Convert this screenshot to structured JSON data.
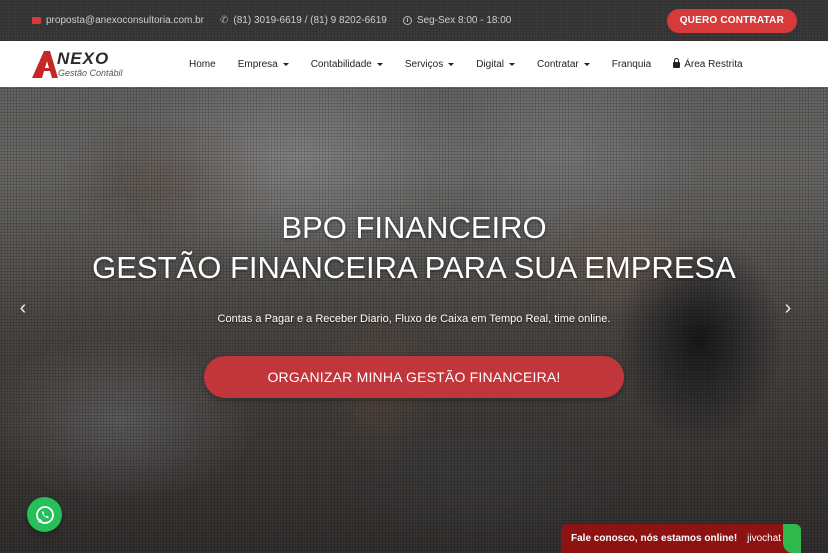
{
  "topbar": {
    "email": "proposta@anexoconsultoria.com.br",
    "phones": "(81) 3019-6619 / (81) 9 8202-6619",
    "hours": "Seg-Sex 8:00 - 18:00",
    "cta_label": "QUERO CONTRATAR",
    "icons": [
      "envelope-icon",
      "phone-icon",
      "clock-icon"
    ]
  },
  "logo": {
    "mark": "A",
    "name": "NEXO",
    "tagline": "Gestão Contábil"
  },
  "nav": {
    "items": [
      {
        "label": "Home",
        "dropdown": false
      },
      {
        "label": "Empresa",
        "dropdown": true
      },
      {
        "label": "Contabilidade",
        "dropdown": true
      },
      {
        "label": "Serviços",
        "dropdown": true
      },
      {
        "label": "Digital",
        "dropdown": true
      },
      {
        "label": "Contratar",
        "dropdown": true
      },
      {
        "label": "Franquia",
        "dropdown": false
      },
      {
        "label": "Área Restrita",
        "dropdown": false,
        "icon": "lock-icon"
      }
    ]
  },
  "hero": {
    "headline_line1": "BPO FINANCEIRO",
    "headline_line2": "GESTÃO FINANCEIRA PARA SUA EMPRESA",
    "subtitle": "Contas a Pagar e a Receber Diario, Fluxo de Caixa em Tempo Real, time online.",
    "cta_label": "ORGANIZAR MINHA GESTÃO FINANCEIRA!",
    "prev_arrow": "‹",
    "next_arrow": "›"
  },
  "chat": {
    "message": "Fale conosco, nós estamos online!",
    "brand": "jivochat"
  },
  "colors": {
    "accent": "#d63a3a",
    "nav_bg": "#ffffff",
    "whatsapp": "#25c05a",
    "jivo_bg": "#8d1212"
  }
}
